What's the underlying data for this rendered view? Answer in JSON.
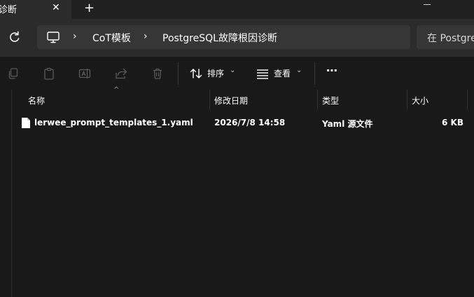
{
  "tab": {
    "title": "诊断",
    "close": "✕",
    "new_tab": "+"
  },
  "breadcrumb": {
    "separator": "›",
    "items": [
      "CoT模板",
      "PostgreSQL故障根因诊断"
    ]
  },
  "search": {
    "placeholder": "在 Postgre"
  },
  "toolbar": {
    "sort_label": "排序",
    "view_label": "查看",
    "chevron": "⌄",
    "more": "⋯"
  },
  "columns": {
    "sort_indicator": "^",
    "name": "名称",
    "modified": "修改日期",
    "type": "类型",
    "size": "大小"
  },
  "files": [
    {
      "name": "lerwee_prompt_templates_1.yaml",
      "modified": "2026/7/8 14:58",
      "type": "Yaml 源文件",
      "size": "6 KB"
    }
  ],
  "icons": {
    "refresh": "refresh-icon",
    "computer": "computer-icon",
    "copy": "copy-icon",
    "paste": "paste-icon",
    "rename": "rename-icon",
    "share": "share-icon",
    "delete": "delete-icon",
    "sort": "sort-icon",
    "view": "view-icon",
    "file": "file-icon"
  }
}
